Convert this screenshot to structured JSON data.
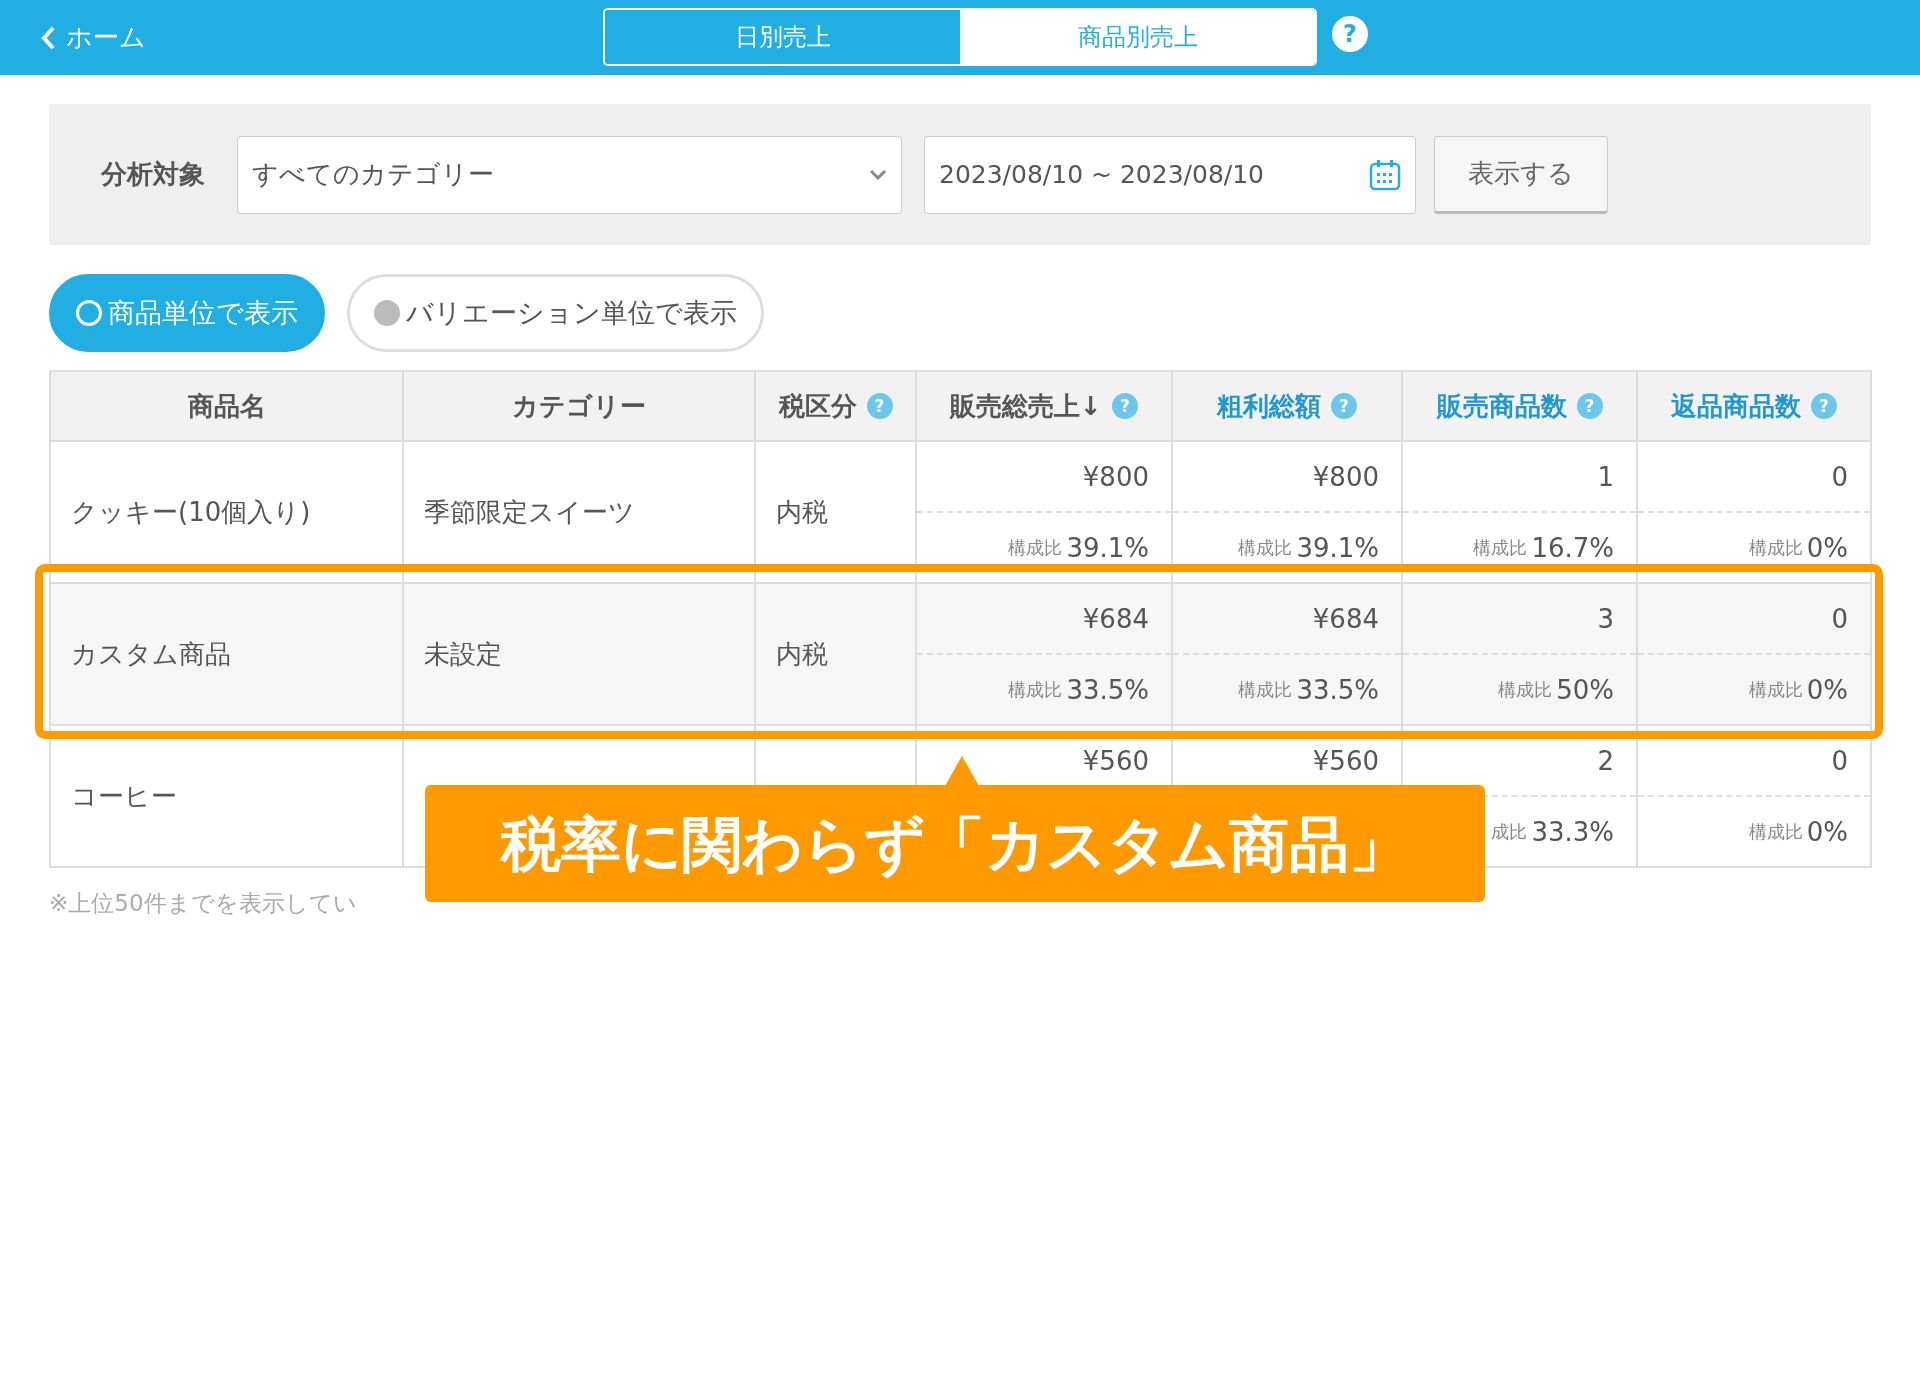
{
  "header": {
    "back": "ホーム",
    "tabs": [
      {
        "label": "日別売上",
        "selected": true
      },
      {
        "label": "商品別売上",
        "selected": false
      }
    ],
    "help": "?"
  },
  "filter": {
    "label": "分析対象",
    "category": "すべてのカテゴリー",
    "date_range": "2023/08/10 ~ 2023/08/10",
    "submit": "表示する"
  },
  "view_toggle": [
    {
      "label": "商品単位で表示",
      "selected": true
    },
    {
      "label": "バリエーション単位で表示",
      "selected": false
    }
  ],
  "table": {
    "columns": [
      {
        "label": "商品名",
        "link": false
      },
      {
        "label": "カテゴリー",
        "link": false
      },
      {
        "label": "税区分",
        "help": "?",
        "link": false
      },
      {
        "label": "販売総売上↓",
        "help": "?",
        "link": false
      },
      {
        "label": "粗利総額",
        "help": "?",
        "link": true
      },
      {
        "label": "販売商品数",
        "help": "?",
        "link": true
      },
      {
        "label": "返品商品数",
        "help": "?",
        "link": true
      }
    ],
    "rows": [
      {
        "product": "クッキー(10個入り)",
        "category": "季節限定スイーツ",
        "tax": "内税",
        "metrics": [
          {
            "value": "¥800",
            "ratio_label": "構成比",
            "ratio": "39.1%"
          },
          {
            "value": "¥800",
            "ratio_label": "構成比",
            "ratio": "39.1%"
          },
          {
            "value": "1",
            "ratio_label": "構成比",
            "ratio": "16.7%"
          },
          {
            "value": "0",
            "ratio_label": "構成比",
            "ratio": "0%"
          }
        ]
      },
      {
        "product": "カスタム商品",
        "category": "未設定",
        "tax": "内税",
        "highlighted": true,
        "metrics": [
          {
            "value": "¥684",
            "ratio_label": "構成比",
            "ratio": "33.5%"
          },
          {
            "value": "¥684",
            "ratio_label": "構成比",
            "ratio": "33.5%"
          },
          {
            "value": "3",
            "ratio_label": "構成比",
            "ratio": "50%"
          },
          {
            "value": "0",
            "ratio_label": "構成比",
            "ratio": "0%"
          }
        ]
      },
      {
        "product": "コーヒー",
        "metrics": [
          {
            "value": "¥560"
          },
          {
            "value": "¥560"
          },
          {
            "value": "2",
            "ratio_label": "成比",
            "ratio": "33.3%"
          },
          {
            "value": "0",
            "ratio_label": "構成比",
            "ratio": "0%"
          }
        ]
      }
    ]
  },
  "footnote": "※上位50件までを表示してい",
  "callout": "税率に関わらず「カスタム商品」"
}
